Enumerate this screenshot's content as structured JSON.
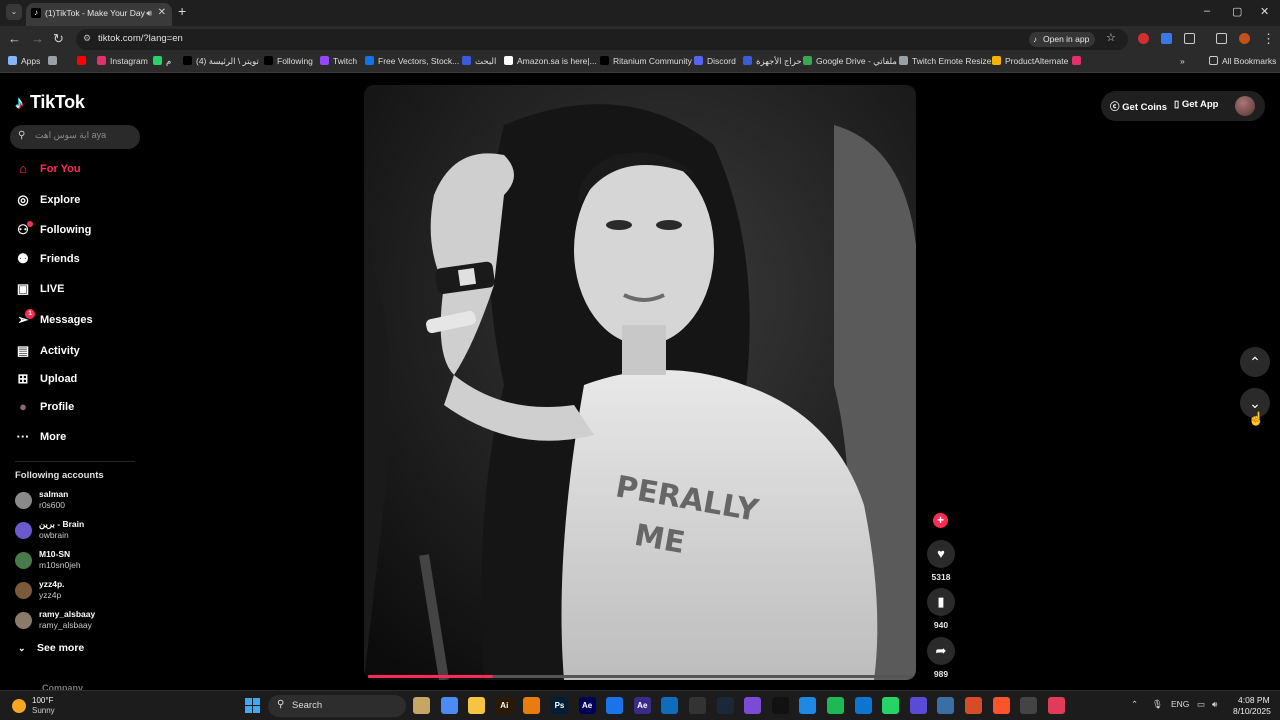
{
  "browser": {
    "tab_title": "(1)TikTok - Make Your Day",
    "tab_favicon": "tiktok-icon",
    "new_tab": "+",
    "url": "tiktok.com/?lang=en",
    "open_in_app": "Open in app",
    "window_controls": [
      "–",
      "▢",
      "✕"
    ]
  },
  "bookmarks": [
    {
      "label": "Apps",
      "icon": "apps-grid-icon",
      "color": "#8ab4f8"
    },
    {
      "label": "",
      "icon": "youtube-icon",
      "color": "#ff0000"
    },
    {
      "label": "",
      "icon": "grid-icon",
      "color": "#9aa0a6"
    },
    {
      "label": "Instagram",
      "icon": "instagram-icon",
      "color": "#e1306c"
    },
    {
      "label": "م",
      "icon": "whatsapp-icon",
      "color": "#25d366"
    },
    {
      "label": "(4) تويتر \\ الرئيسة",
      "icon": "x-icon",
      "color": "#000000"
    },
    {
      "label": "Following",
      "icon": "x-icon",
      "color": "#000000"
    },
    {
      "label": "Twitch",
      "icon": "twitch-icon",
      "color": "#9146ff"
    },
    {
      "label": "Free Vectors, Stock...",
      "icon": "freepik-icon",
      "color": "#1273eb"
    },
    {
      "label": "البحث",
      "icon": "site-icon",
      "color": "#3b5bdb"
    },
    {
      "label": "Amazon.sa is here|...",
      "icon": "amazon-icon",
      "color": "#ffffff"
    },
    {
      "label": "Ritanium Community",
      "icon": "x-icon",
      "color": "#000000"
    },
    {
      "label": "Discord",
      "icon": "discord-icon",
      "color": "#5865f2"
    },
    {
      "label": "حراج الأجهزة",
      "icon": "site-icon",
      "color": "#3b5bdb"
    },
    {
      "label": "Google Drive - ملفاتي",
      "icon": "google-drive-icon",
      "color": "#34a853"
    },
    {
      "label": "Twitch Emote Resizer",
      "icon": "globe-icon",
      "color": "#9aa0a6"
    },
    {
      "label": "ProductAlternate",
      "icon": "product-icon",
      "color": "#f4b400"
    },
    {
      "label": "",
      "icon": "instagram-icon",
      "color": "#e1306c"
    }
  ],
  "bookmarks_more": "»",
  "all_bookmarks": "All Bookmarks",
  "tiktok": {
    "logo": "TikTok",
    "search_placeholder": "اية سوس اهت aya",
    "nav": [
      {
        "label": "For You",
        "icon": "home-icon",
        "active": true
      },
      {
        "label": "Explore",
        "icon": "compass-icon"
      },
      {
        "label": "Following",
        "icon": "user-plus-icon"
      },
      {
        "label": "Friends",
        "icon": "friends-icon"
      },
      {
        "label": "LIVE",
        "icon": "live-icon"
      },
      {
        "label": "Messages",
        "icon": "send-icon",
        "badge": "1"
      },
      {
        "label": "Activity",
        "icon": "activity-icon"
      },
      {
        "label": "Upload",
        "icon": "plus-square-icon"
      },
      {
        "label": "Profile",
        "icon": "profile-avatar"
      },
      {
        "label": "More",
        "icon": "more-dots-icon"
      }
    ],
    "following_accounts_title": "Following accounts",
    "following_accounts": [
      {
        "name": "salman",
        "handle": "r0s600",
        "color": "#8a8a8a"
      },
      {
        "name": "برين - Brain",
        "handle": "owbrain",
        "color": "#6a5acd"
      },
      {
        "name": "M10-SN",
        "handle": "m10sn0jeh",
        "color": "#4a7a4a"
      },
      {
        "name": "yzz4p.",
        "handle": "yzz4p",
        "color": "#7a5a3a"
      },
      {
        "name": "ramy_alsbaay",
        "handle": "ramy_alsbaay",
        "color": "#8a7a6a"
      }
    ],
    "see_more": "See more",
    "company": "Company",
    "get_coins": "Get Coins",
    "get_app": "Get App",
    "video_progress": 0.23,
    "actions": {
      "likes": "5318",
      "saves": "940",
      "shares": "989"
    }
  },
  "taskbar": {
    "weather_temp": "100°F",
    "weather_cond": "Sunny",
    "search": "Search",
    "lang": "ENG",
    "time": "4:08 PM",
    "date": "8/10/2025",
    "apps": [
      {
        "label": "",
        "color": "#c6a664"
      },
      {
        "label": "",
        "color": "#4b8bf5"
      },
      {
        "label": "",
        "color": "#f5c542"
      },
      {
        "label": "Ai",
        "color": "#2b1a00"
      },
      {
        "label": "",
        "color": "#e87d0d"
      },
      {
        "label": "Ps",
        "color": "#001e36"
      },
      {
        "label": "Ae",
        "color": "#00005b"
      },
      {
        "label": "",
        "color": "#1a73e8"
      },
      {
        "label": "Ae",
        "color": "#3a2a8a"
      },
      {
        "label": "",
        "color": "#0f6cbd"
      },
      {
        "label": "",
        "color": "#333333"
      },
      {
        "label": "",
        "color": "#1b2838"
      },
      {
        "label": "",
        "color": "#7b4bd6"
      },
      {
        "label": "",
        "color": "#111111"
      },
      {
        "label": "",
        "color": "#1e88e5"
      },
      {
        "label": "",
        "color": "#1db954"
      },
      {
        "label": "",
        "color": "#0b75cf"
      },
      {
        "label": "",
        "color": "#25d366"
      },
      {
        "label": "",
        "color": "#5a4bd6"
      },
      {
        "label": "",
        "color": "#3a6ea5"
      },
      {
        "label": "",
        "color": "#d64b2a"
      },
      {
        "label": "",
        "color": "#fb542b"
      },
      {
        "label": "",
        "color": "#444444"
      },
      {
        "label": "",
        "color": "#e33a5a"
      }
    ]
  }
}
